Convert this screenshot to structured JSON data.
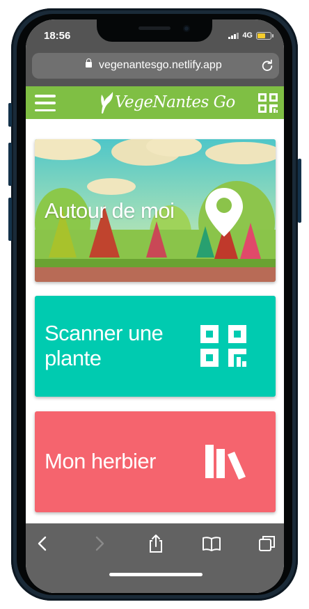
{
  "status_bar": {
    "time": "18:56",
    "network": "4G",
    "battery_color": "#f5cc2c"
  },
  "browser": {
    "url": "vegenantesgo.netlify.app",
    "lock_icon": "lock-icon",
    "reload_icon": "reload-icon"
  },
  "app_header": {
    "brand_color": "#7fbf44",
    "logo_text": "VegeNantes Go",
    "menu_icon": "hamburger-menu-icon",
    "qr_icon": "qr-code-icon"
  },
  "cards": [
    {
      "label": "Autour de moi",
      "icon": "map-pin-icon",
      "background": "forest-illustration"
    },
    {
      "label_line1": "Scanner une",
      "label_line2": "plante",
      "icon": "qr-code-icon",
      "color": "#00cbb0"
    },
    {
      "label": "Mon herbier",
      "icon": "books-icon",
      "color": "#f5646e"
    }
  ],
  "toolbar": {
    "items": [
      "back-icon",
      "forward-icon",
      "share-icon",
      "bookmarks-icon",
      "tabs-icon"
    ]
  }
}
